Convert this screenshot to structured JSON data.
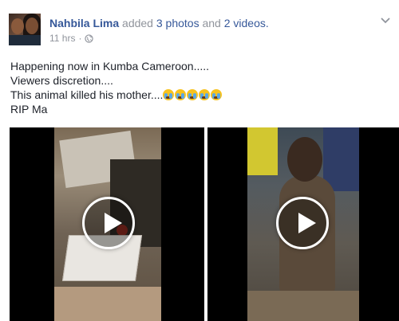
{
  "post": {
    "author": "Nahbila Lima",
    "action_prefix": "added",
    "action_count": "3 photos",
    "action_joiner": "and",
    "action_videos": "2 videos.",
    "timestamp": "11 hrs",
    "separator": "·",
    "privacy_icon": "globe-icon",
    "menu_icon": "chevron-down-icon",
    "text_lines": [
      "Happening now in Kumba Cameroon.....",
      "Viewers discretion....",
      "This animal killed his mother....",
      "RIP Ma"
    ],
    "emoji_icon": "crying-face-icon",
    "emoji_count": 5
  },
  "media": {
    "items": [
      {
        "type": "video",
        "icon": "play-icon"
      },
      {
        "type": "video",
        "icon": "play-icon"
      }
    ]
  },
  "colors": {
    "link": "#365899",
    "meta": "#90949c",
    "text": "#1d2129"
  }
}
